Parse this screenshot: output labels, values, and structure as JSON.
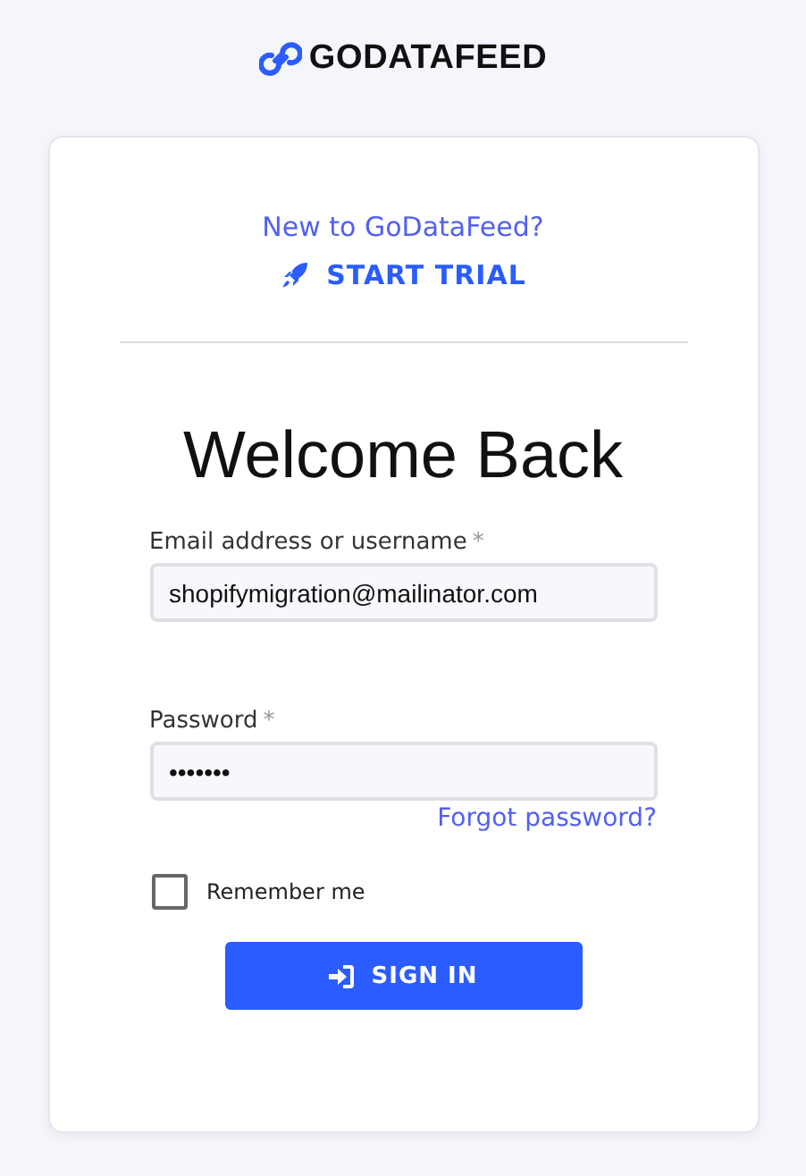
{
  "logo": {
    "text": "GODATAFEED"
  },
  "signup": {
    "prompt": "New to GoDataFeed?",
    "action": "START TRIAL"
  },
  "heading": "Welcome Back",
  "fields": [
    {
      "label": "Email address or username",
      "required_mark": "*",
      "value": "shopifymigration@mailinator.com"
    },
    {
      "label": "Password",
      "required_mark": "*",
      "value": "•••••••"
    }
  ],
  "forgot_link": "Forgot password?",
  "remember": {
    "label": "Remember me",
    "checked": false
  },
  "submit": "SIGN IN"
}
